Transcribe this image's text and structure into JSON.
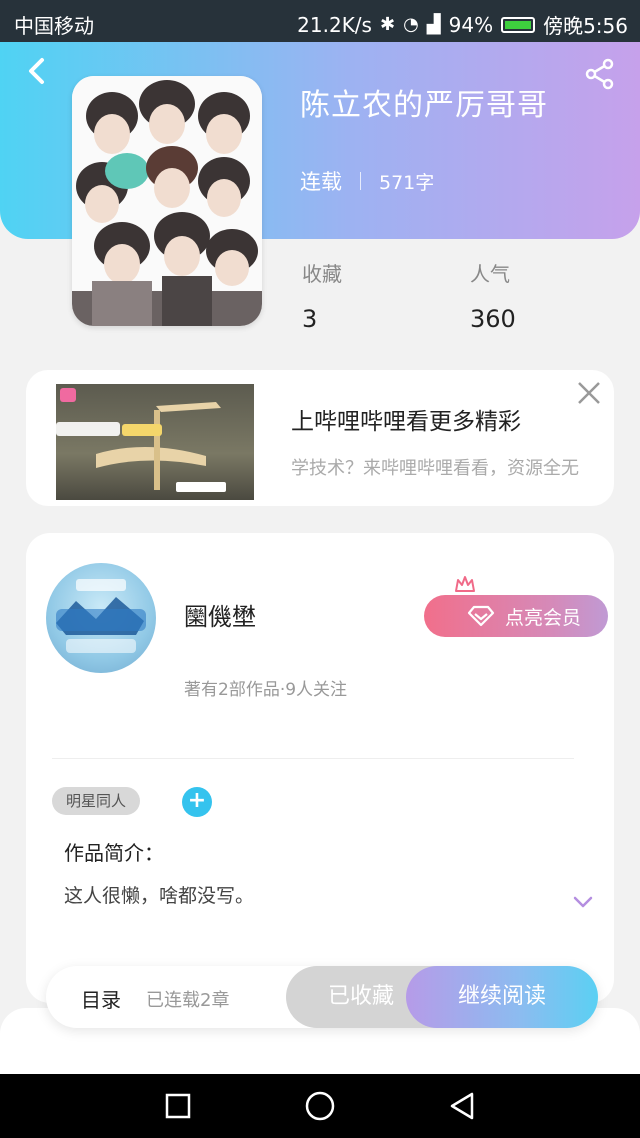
{
  "status_bar": {
    "carrier": "中国移动",
    "speed": "21.2K/s",
    "battery": "94%",
    "time": "傍晚5:56"
  },
  "book": {
    "title": "陈立农的严厉哥哥",
    "status": "连载",
    "word_count": "571字",
    "favorites_label": "收藏",
    "favorites_value": "3",
    "popularity_label": "人气",
    "popularity_value": "360"
  },
  "ad": {
    "title": "上哔哩哔哩看更多精彩",
    "description": "学技术？来哔哩哔哩看看，资源全无"
  },
  "author": {
    "name": "圞僟壄",
    "stats": "著有2部作品·9人关注",
    "vip_label": "点亮会员"
  },
  "work": {
    "tag": "明星同人",
    "intro_label": "作品简介：",
    "intro_text": "这人很懒，啥都没写。"
  },
  "actions": {
    "toc_label": "目录",
    "chapter_count": "已连载2章",
    "collected_label": "已收藏",
    "read_label": "继续阅读"
  },
  "colors": {
    "header_start": "#4fd3f3",
    "header_end": "#c6a1eb",
    "vip_start": "#f16f8b",
    "accent_blue": "#35c3ee"
  }
}
